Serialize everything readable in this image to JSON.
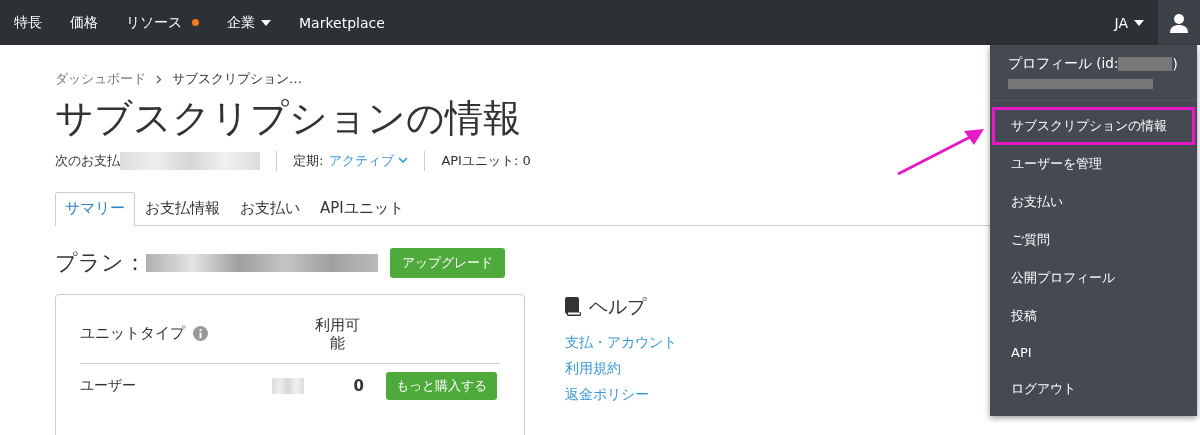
{
  "nav": {
    "items": [
      {
        "label": "特長"
      },
      {
        "label": "価格"
      },
      {
        "label": "リソース",
        "dot": true
      },
      {
        "label": "企業",
        "caret": true
      },
      {
        "label": "Marketplace"
      }
    ],
    "language": "JA"
  },
  "breadcrumb": [
    "ダッシュボード",
    "サブスクリプション…"
  ],
  "title": "サブスクリプションの情報",
  "meta": {
    "next_payment_label": "次のお支払",
    "plan_label": "定期:",
    "plan_status": "アクティブ",
    "api_units": "APIユニット: 0"
  },
  "tabs": [
    {
      "label": "サマリー",
      "selected": true
    },
    {
      "label": "お支払情報",
      "selected": false
    },
    {
      "label": "お支払い",
      "selected": false
    },
    {
      "label": "APIユニット",
      "selected": false
    }
  ],
  "plan": {
    "label": "プラン：",
    "button": "アップグレード"
  },
  "units_table": {
    "columns": [
      "ユニットタイプ",
      "利用可能"
    ],
    "rows": [
      {
        "type": "ユーザー",
        "available": "0",
        "button": "もっと購入する"
      }
    ]
  },
  "help": {
    "title": "ヘルプ",
    "links": [
      "支払・アカウント",
      "利用規約",
      "返金ポリシー"
    ]
  },
  "user_menu": {
    "profile": "プロフィール (id:",
    "profile_end": ")",
    "items": [
      {
        "label": "サブスクリプションの情報",
        "highlighted": true
      },
      {
        "label": "ユーザーを管理",
        "highlighted": false
      },
      {
        "label": "お支払い",
        "highlighted": false
      },
      {
        "label": "ご質問",
        "highlighted": false
      },
      {
        "label": "公開プロフィール",
        "highlighted": false
      },
      {
        "label": "投稿",
        "highlighted": false
      },
      {
        "label": "API",
        "highlighted": false
      },
      {
        "label": "ログアウト",
        "highlighted": false
      }
    ]
  }
}
